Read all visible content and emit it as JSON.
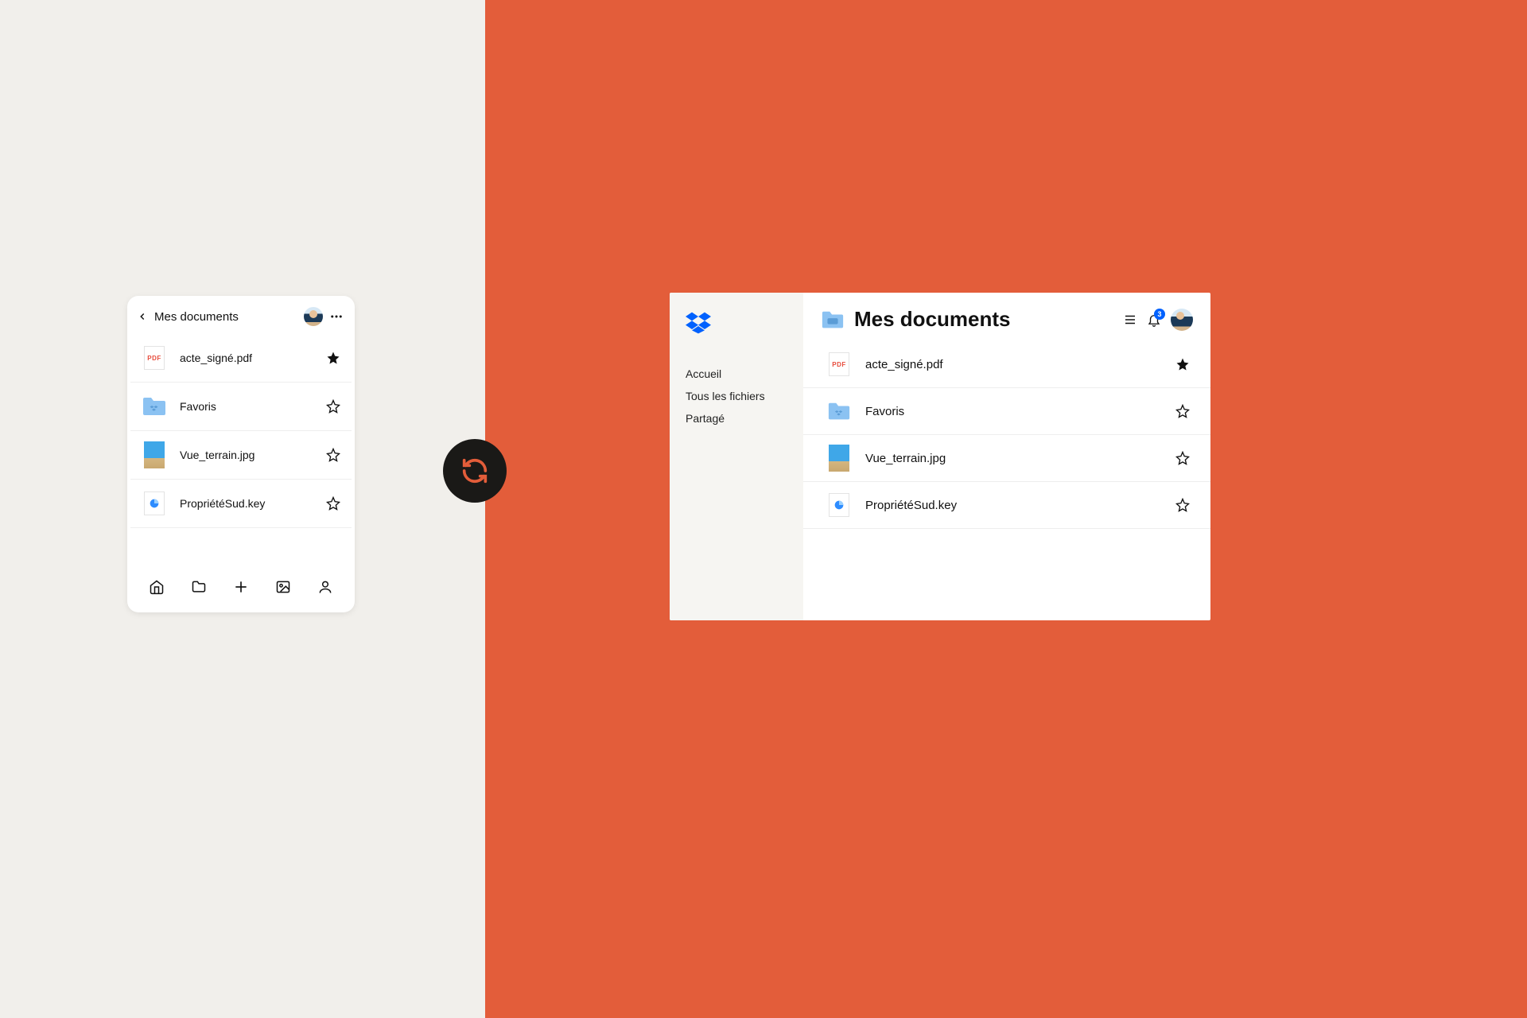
{
  "mobile": {
    "title": "Mes documents",
    "files": [
      {
        "name": "acte_signé.pdf",
        "type": "pdf",
        "starred": true
      },
      {
        "name": "Favoris",
        "type": "folder",
        "starred": false
      },
      {
        "name": "Vue_terrain.jpg",
        "type": "image",
        "starred": false
      },
      {
        "name": "PropriétéSud.key",
        "type": "keynote",
        "starred": false
      }
    ]
  },
  "desktop": {
    "title": "Mes documents",
    "nav": [
      {
        "label": "Accueil"
      },
      {
        "label": "Tous les fichiers"
      },
      {
        "label": "Partagé"
      }
    ],
    "notification_count": "3",
    "files": [
      {
        "name": "acte_signé.pdf",
        "type": "pdf",
        "starred": true
      },
      {
        "name": "Favoris",
        "type": "folder",
        "starred": false
      },
      {
        "name": "Vue_terrain.jpg",
        "type": "image",
        "starred": false
      },
      {
        "name": "PropriétéSud.key",
        "type": "keynote",
        "starred": false
      }
    ]
  },
  "icon_labels": {
    "pdf": "PDF"
  },
  "colors": {
    "accent_orange": "#e35d3a",
    "dropbox_blue": "#0061fe",
    "folder_blue": "#8bc2f2"
  }
}
